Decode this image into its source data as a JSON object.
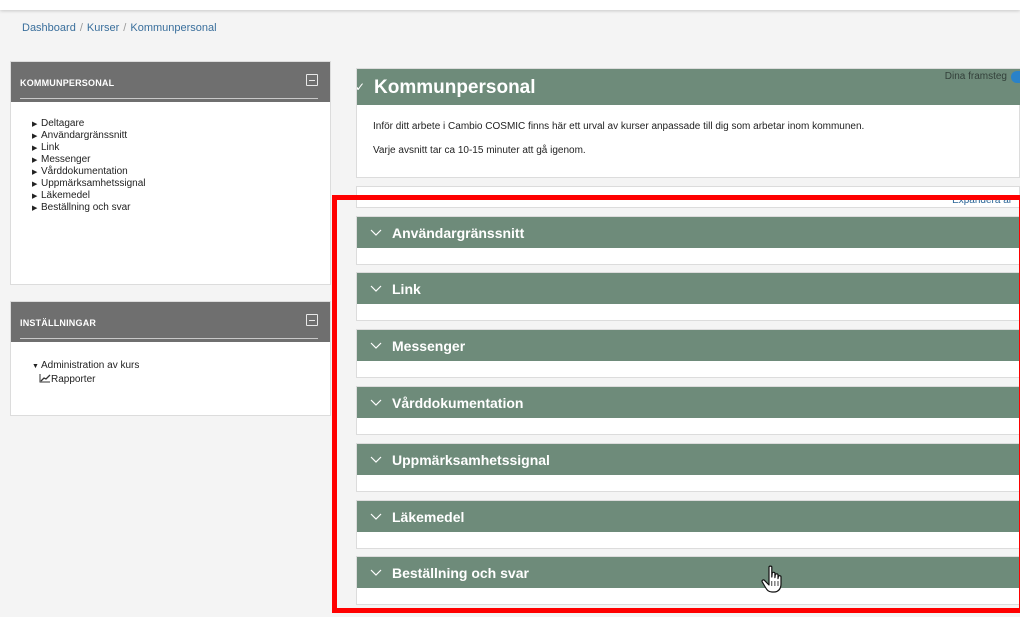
{
  "breadcrumb": [
    "Dashboard",
    "Kurser",
    "Kommunpersonal"
  ],
  "blocks": {
    "navigation": {
      "title": "KOMMUNPERSONAL",
      "items": [
        "Deltagare",
        "Användargränssnitt",
        "Link",
        "Messenger",
        "Vårddokumentation",
        "Uppmärksamhetssignal",
        "Läkemedel",
        "Beställning och svar"
      ]
    },
    "settings": {
      "title": "INSTÄLLNINGAR",
      "admin_label": "Administration av kurs",
      "reports_label": "Rapporter"
    }
  },
  "course": {
    "title": "Kommunpersonal",
    "progress_label": "Dina framsteg",
    "summary_line1": "Inför ditt arbete i Cambio COSMIC finns här ett urval av kurser anpassade till dig som arbetar inom kommunen.",
    "summary_line2": "Varje avsnitt tar ca 10-15 minuter att gå igenom.",
    "expand_all": "Expandera al"
  },
  "sections": [
    "Användargränssnitt",
    "Link",
    "Messenger",
    "Vårddokumentation",
    "Uppmärksamhetssignal",
    "Läkemedel",
    "Beställning och svar"
  ],
  "colors": {
    "section_banner": "#6e8b7a",
    "block_header": "#6f6f6f",
    "highlight": "#ff0000",
    "link": "#3a6f9c"
  },
  "icons": {
    "collapse": "minus-square-icon",
    "section_toggle": "chevron-down-icon",
    "reports": "chart-line-icon",
    "cursor": "hand-pointer-icon"
  }
}
